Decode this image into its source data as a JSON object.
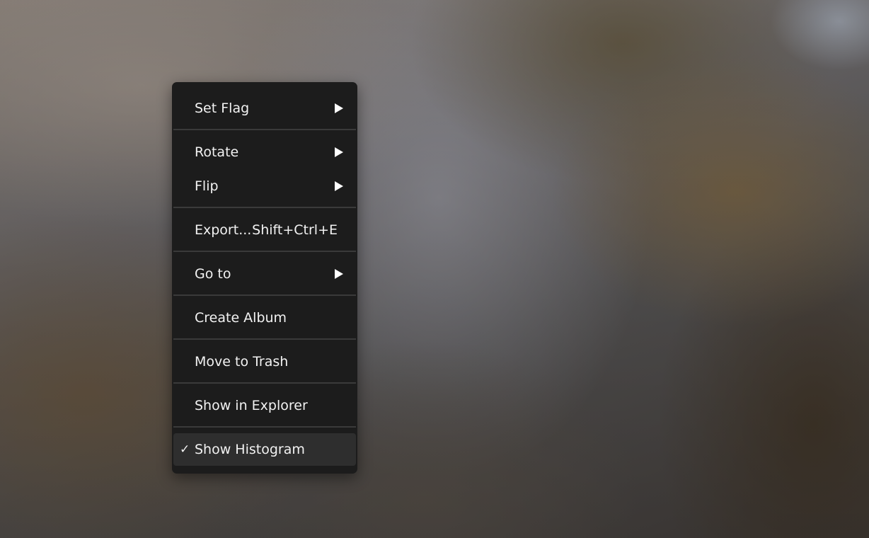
{
  "menu": {
    "items": [
      {
        "label": "Set Flag",
        "shortcut": "",
        "submenu": true,
        "checked": false
      },
      {
        "label": "Rotate",
        "shortcut": "",
        "submenu": true,
        "checked": false
      },
      {
        "label": "Flip",
        "shortcut": "",
        "submenu": true,
        "checked": false
      },
      {
        "label": "Export...",
        "shortcut": "Shift+Ctrl+E",
        "submenu": false,
        "checked": false
      },
      {
        "label": "Go to",
        "shortcut": "",
        "submenu": true,
        "checked": false
      },
      {
        "label": "Create Album",
        "shortcut": "",
        "submenu": false,
        "checked": false
      },
      {
        "label": "Move to Trash",
        "shortcut": "",
        "submenu": false,
        "checked": false
      },
      {
        "label": "Show in Explorer",
        "shortcut": "",
        "submenu": false,
        "checked": false
      },
      {
        "label": "Show Histogram",
        "shortcut": "",
        "submenu": false,
        "checked": true,
        "check_mark": "✓"
      }
    ]
  },
  "colors": {
    "menu_background": "#1c1c1c",
    "menu_text": "#f2f2f2",
    "separator": "#3a3a3a",
    "highlight": "#2e2e2e"
  }
}
